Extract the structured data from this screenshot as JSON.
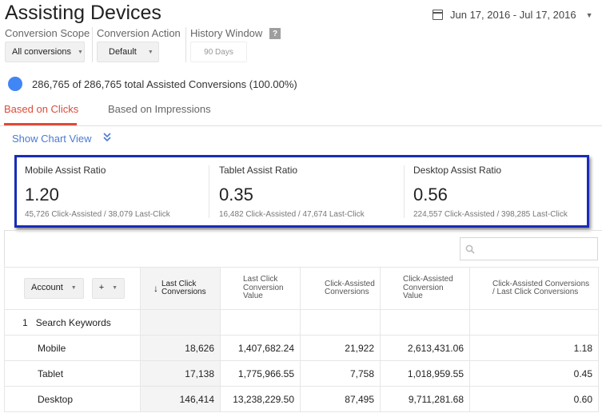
{
  "page": {
    "title": "Assisting Devices",
    "date_range": "Jun 17, 2016 - Jul 17, 2016"
  },
  "filters": {
    "conversion_scope": {
      "label": "Conversion Scope",
      "value": "All conversions"
    },
    "conversion_action": {
      "label": "Conversion Action",
      "value": "Default"
    },
    "history_window": {
      "label": "History Window",
      "help": "?",
      "value": "90 Days"
    }
  },
  "summary": {
    "text": "286,765 of 286,765 total Assisted Conversions (100.00%)",
    "dot_color": "#4285f4"
  },
  "tabs": [
    {
      "label": "Based on Clicks",
      "active": true
    },
    {
      "label": "Based on Impressions",
      "active": false
    }
  ],
  "chart_toggle": {
    "label": "Show Chart View",
    "icon": "double-chevron-down-icon"
  },
  "ratios": [
    {
      "label": "Mobile Assist Ratio",
      "value": "1.20",
      "detail": "45,726 Click-Assisted / 38,079 Last-Click"
    },
    {
      "label": "Tablet Assist Ratio",
      "value": "0.35",
      "detail": "16,482 Click-Assisted / 47,674 Last-Click"
    },
    {
      "label": "Desktop Assist Ratio",
      "value": "0.56",
      "detail": "224,557 Click-Assisted / 398,285 Last-Click"
    }
  ],
  "highlight_color": "#1a2cb8",
  "table": {
    "dimension_button": "Account",
    "add_button": "+",
    "sort_arrow": "↓",
    "headers": [
      "Last Click Conversions",
      "Last Click Conversion Value",
      "Click-Assisted Conversions",
      "Click-Assisted Conversion Value",
      "Click-Assisted Conversions / Last Click Conversions"
    ],
    "group_row": {
      "index": "1",
      "label": "Search Keywords"
    },
    "rows": [
      {
        "label": "Mobile",
        "cells": [
          "18,626",
          "1,407,682.24",
          "21,922",
          "2,613,431.06",
          "1.18"
        ]
      },
      {
        "label": "Tablet",
        "cells": [
          "17,138",
          "1,775,966.55",
          "7,758",
          "1,018,959.55",
          "0.45"
        ]
      },
      {
        "label": "Desktop",
        "cells": [
          "146,414",
          "13,238,229.50",
          "87,495",
          "9,711,281.68",
          "0.60"
        ]
      }
    ]
  }
}
